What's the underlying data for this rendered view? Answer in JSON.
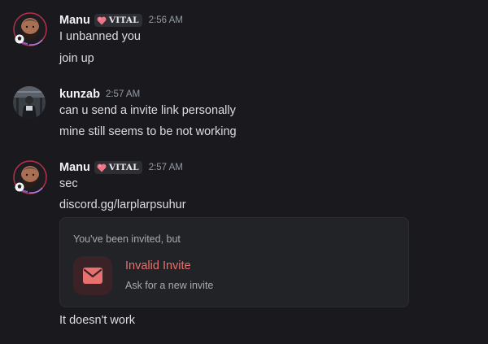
{
  "messages": [
    {
      "author": "Manu",
      "tag": "VITAL",
      "time": "2:56 AM",
      "lines": [
        "I unbanned you",
        "join up"
      ]
    },
    {
      "author": "kunzab",
      "time": "2:57 AM",
      "lines": [
        "can u send a invite link personally",
        "mine still seems to be not working"
      ]
    },
    {
      "author": "Manu",
      "tag": "VITAL",
      "time": "2:57 AM",
      "lines": [
        "sec",
        "discord.gg/larplarpsuhur"
      ],
      "invite": {
        "heading": "You've been invited, but",
        "title": "Invalid Invite",
        "subtitle": "Ask for a new invite",
        "icon": "envelope-icon"
      },
      "after_lines": [
        "It doesn't work"
      ]
    }
  ],
  "colors": {
    "background": "#1a1a1e",
    "text": "#dbdee1",
    "username": "#f2f3f5",
    "timestamp": "#949ba4",
    "invalid": "#e5726f",
    "tag_heart": "#f0758a"
  },
  "icons": {
    "avatar_manu": "bearded-man-avatar",
    "avatar_kunzab": "photo-avatar",
    "tag_icon": "heart-icon"
  }
}
